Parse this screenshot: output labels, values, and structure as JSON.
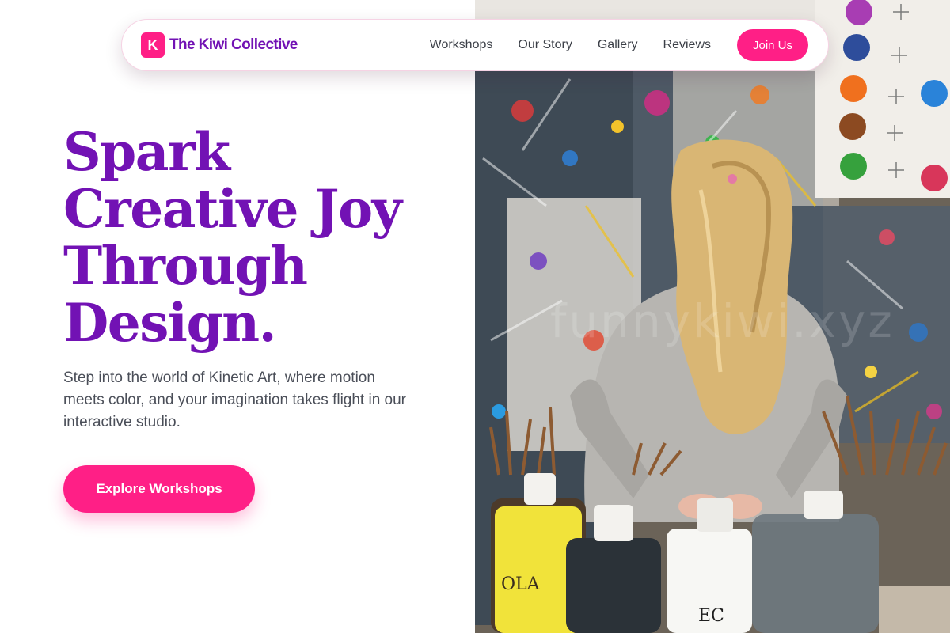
{
  "brand": {
    "mark": "K",
    "name": "The Kiwi Collective",
    "accent_color": "#ff1f86",
    "title_color": "#7212b4"
  },
  "nav": {
    "links": [
      "Workshops",
      "Our Story",
      "Gallery",
      "Reviews"
    ],
    "join_label": "Join Us"
  },
  "hero": {
    "title_lines": [
      "Spark",
      "Creative Joy",
      "Through",
      "Design."
    ],
    "subtitle": "Step into the world of Kinetic Art, where motion meets color, and your imagination takes flight in our interactive studio.",
    "cta_label": "Explore Workshops"
  },
  "photo": {
    "watermark": "funnykiwi.xyz",
    "icons": {
      "photo": "photo-icon"
    }
  }
}
